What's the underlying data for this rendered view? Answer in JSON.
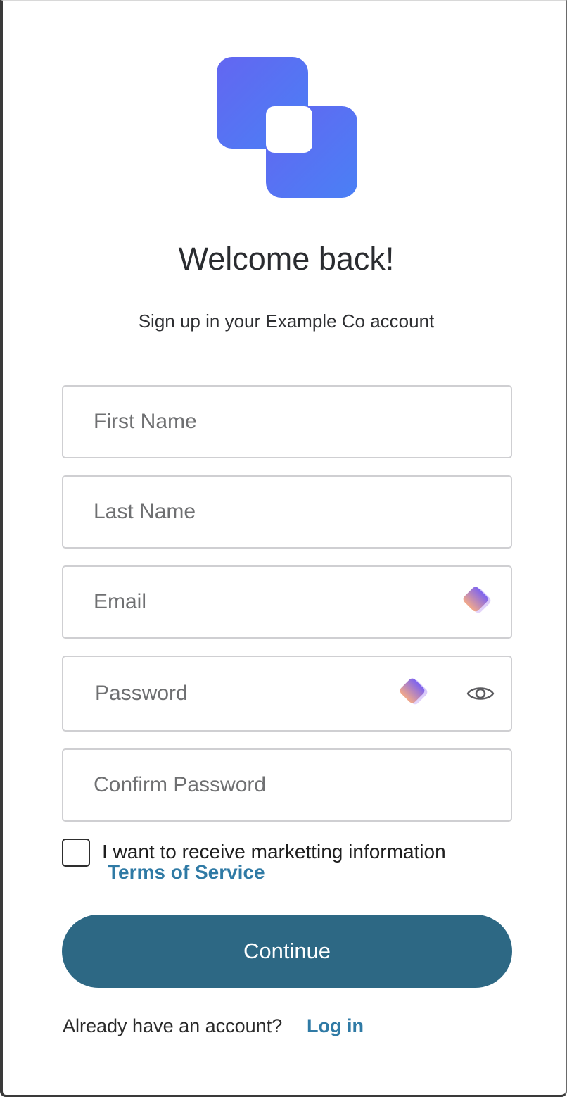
{
  "header": {
    "title": "Welcome back!",
    "subtitle": "Sign up in your Example Co account"
  },
  "form": {
    "first_name": {
      "placeholder": "First Name",
      "value": ""
    },
    "last_name": {
      "placeholder": "Last Name",
      "value": ""
    },
    "email": {
      "placeholder": "Email",
      "value": ""
    },
    "password": {
      "placeholder": "Password",
      "value": ""
    },
    "confirm_password": {
      "placeholder": "Confirm Password",
      "value": ""
    },
    "marketing_checkbox": {
      "label": "I want to receive marketting information",
      "checked": false
    },
    "terms_link": "Terms of Service",
    "continue_label": "Continue"
  },
  "footer": {
    "prompt": "Already have an account?",
    "login_link": "Log in"
  },
  "icons": {
    "logo": "brand-logo-icon",
    "password_manager": "password-manager-icon",
    "show_password": "eye-icon"
  },
  "colors": {
    "logo_gradient_start": "#6366f1",
    "logo_gradient_end": "#4a80f5",
    "primary_button": "#2d6884",
    "link": "#2f7aa5",
    "field_border": "#cfcfd2"
  }
}
